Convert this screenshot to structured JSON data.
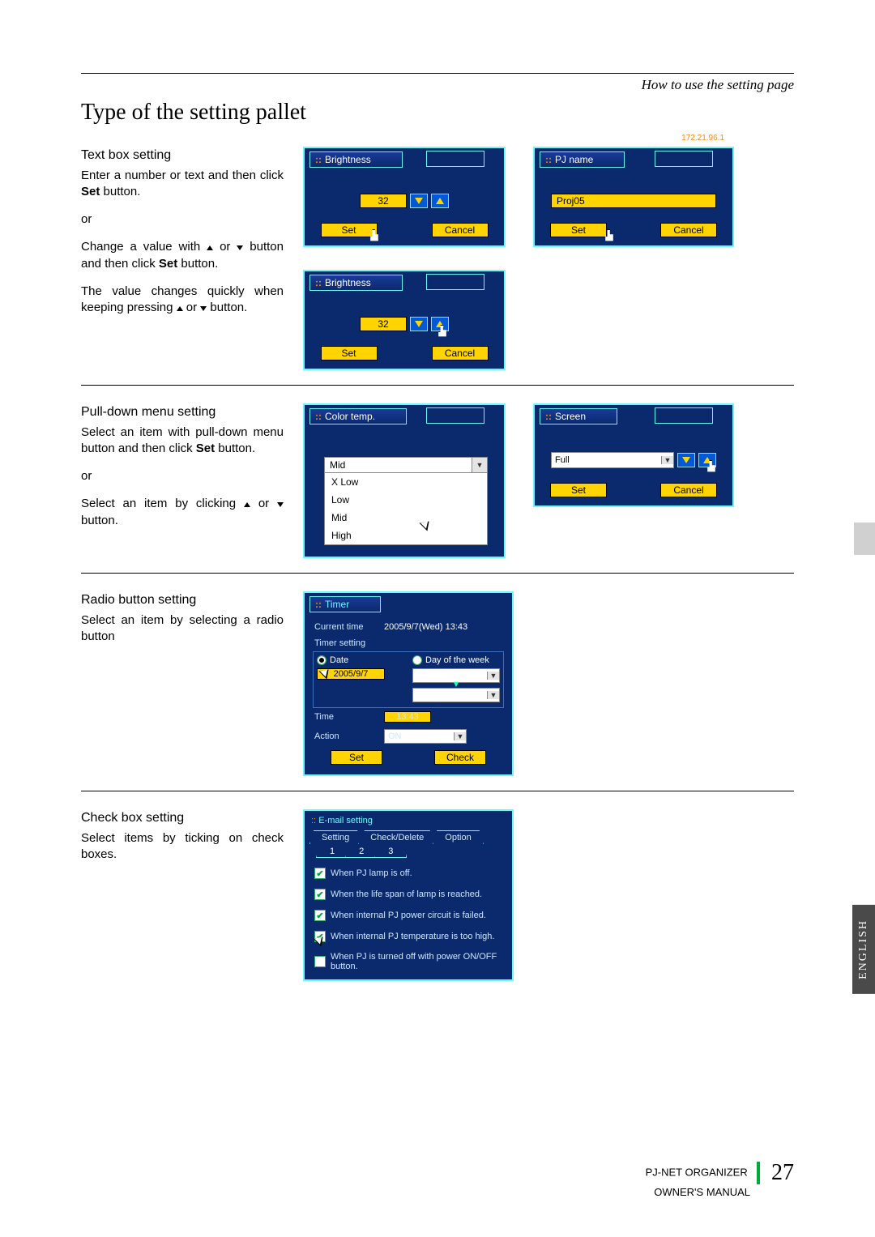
{
  "header": {
    "caption": "How to use the setting page",
    "title": "Type of the setting pallet"
  },
  "textbox": {
    "heading": "Text box setting",
    "p1a": "Enter a number or text and then click ",
    "p1b": " button.",
    "or": "or",
    "p2a": "Change a value with ",
    "p2b": " or ",
    "p2c": " button and then click ",
    "p2d": " button.",
    "p3a": "The value changes quickly when keeping pressing ",
    "p3b": " or ",
    "p3c": " button.",
    "set": "Set"
  },
  "panels": {
    "brightness": {
      "title": "Brightness",
      "value": "32",
      "set": "Set",
      "cancel": "Cancel"
    },
    "pjname": {
      "title": "PJ name",
      "ip": "172.21.96.1",
      "value": "Proj05",
      "set": "Set",
      "cancel": "Cancel"
    },
    "colortemp": {
      "title": "Color temp.",
      "selected": "Mid",
      "options": [
        "X Low",
        "Low",
        "Mid",
        "High"
      ]
    },
    "screen": {
      "title": "Screen",
      "selected": "Full",
      "set": "Set",
      "cancel": "Cancel"
    },
    "timer": {
      "title": "Timer",
      "current_label": "Current time",
      "current_value": "2005/9/7(Wed) 13:43",
      "setting_label": "Timer setting",
      "radio_date": "Date",
      "radio_dow": "Day of the week",
      "date_value": "2005/9/7",
      "time_label": "Time",
      "time_value": "13:43",
      "action_label": "Action",
      "action_value": "ON",
      "set": "Set",
      "check": "Check"
    },
    "email": {
      "title": "E-mail setting",
      "tabs": [
        "Setting",
        "Check/Delete",
        "Option"
      ],
      "numtabs": [
        "1",
        "2",
        "3"
      ],
      "items": [
        {
          "checked": true,
          "label": "When PJ lamp is off."
        },
        {
          "checked": true,
          "label": "When the life span of lamp is reached."
        },
        {
          "checked": true,
          "label": "When internal PJ power circuit is failed."
        },
        {
          "checked": true,
          "label": "When internal PJ temperature is too high."
        },
        {
          "checked": false,
          "label": "When PJ is turned off with power ON/OFF button."
        }
      ]
    }
  },
  "pulldown": {
    "heading": "Pull-down menu setting",
    "p1a": "Select an item with pull-down menu button and then click ",
    "p1b": " button.",
    "or": "or",
    "p2a": "Select an item by clicking ",
    "p2b": " or ",
    "p2c": " button.",
    "set": "Set"
  },
  "radio": {
    "heading": "Radio button setting",
    "p1": "Select an item by selecting a radio button"
  },
  "checkbox": {
    "heading": "Check box setting",
    "p1": "Select items by ticking on check boxes."
  },
  "side_tab": "ENGLISH",
  "footer": {
    "line1": "PJ-NET ORGANIZER",
    "line2": "OWNER'S MANUAL",
    "page": "27"
  }
}
